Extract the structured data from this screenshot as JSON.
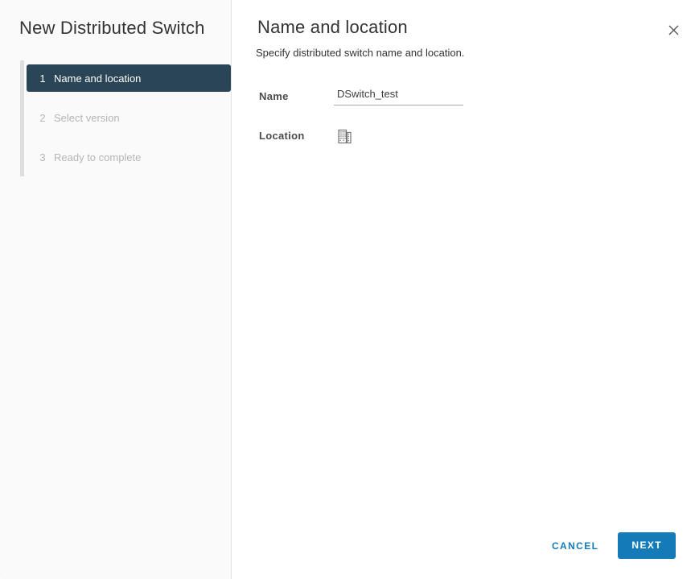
{
  "dialog": {
    "title": "New Distributed Switch",
    "steps": [
      {
        "number": "1",
        "label": "Name and location"
      },
      {
        "number": "2",
        "label": "Select version"
      },
      {
        "number": "3",
        "label": "Ready to complete"
      }
    ],
    "page": {
      "title": "Name and location",
      "subtitle": "Specify distributed switch name and location."
    },
    "form": {
      "name_label": "Name",
      "name_value": "DSwitch_test",
      "location_label": "Location",
      "location_icon": "datacenter-icon"
    },
    "footer": {
      "cancel_label": "CANCEL",
      "next_label": "NEXT"
    },
    "icons": {
      "close": "close-icon"
    },
    "colors": {
      "accent_blue": "#147ab8",
      "active_step_bg": "#2a4656",
      "sidebar_bg": "#fafafa"
    }
  }
}
